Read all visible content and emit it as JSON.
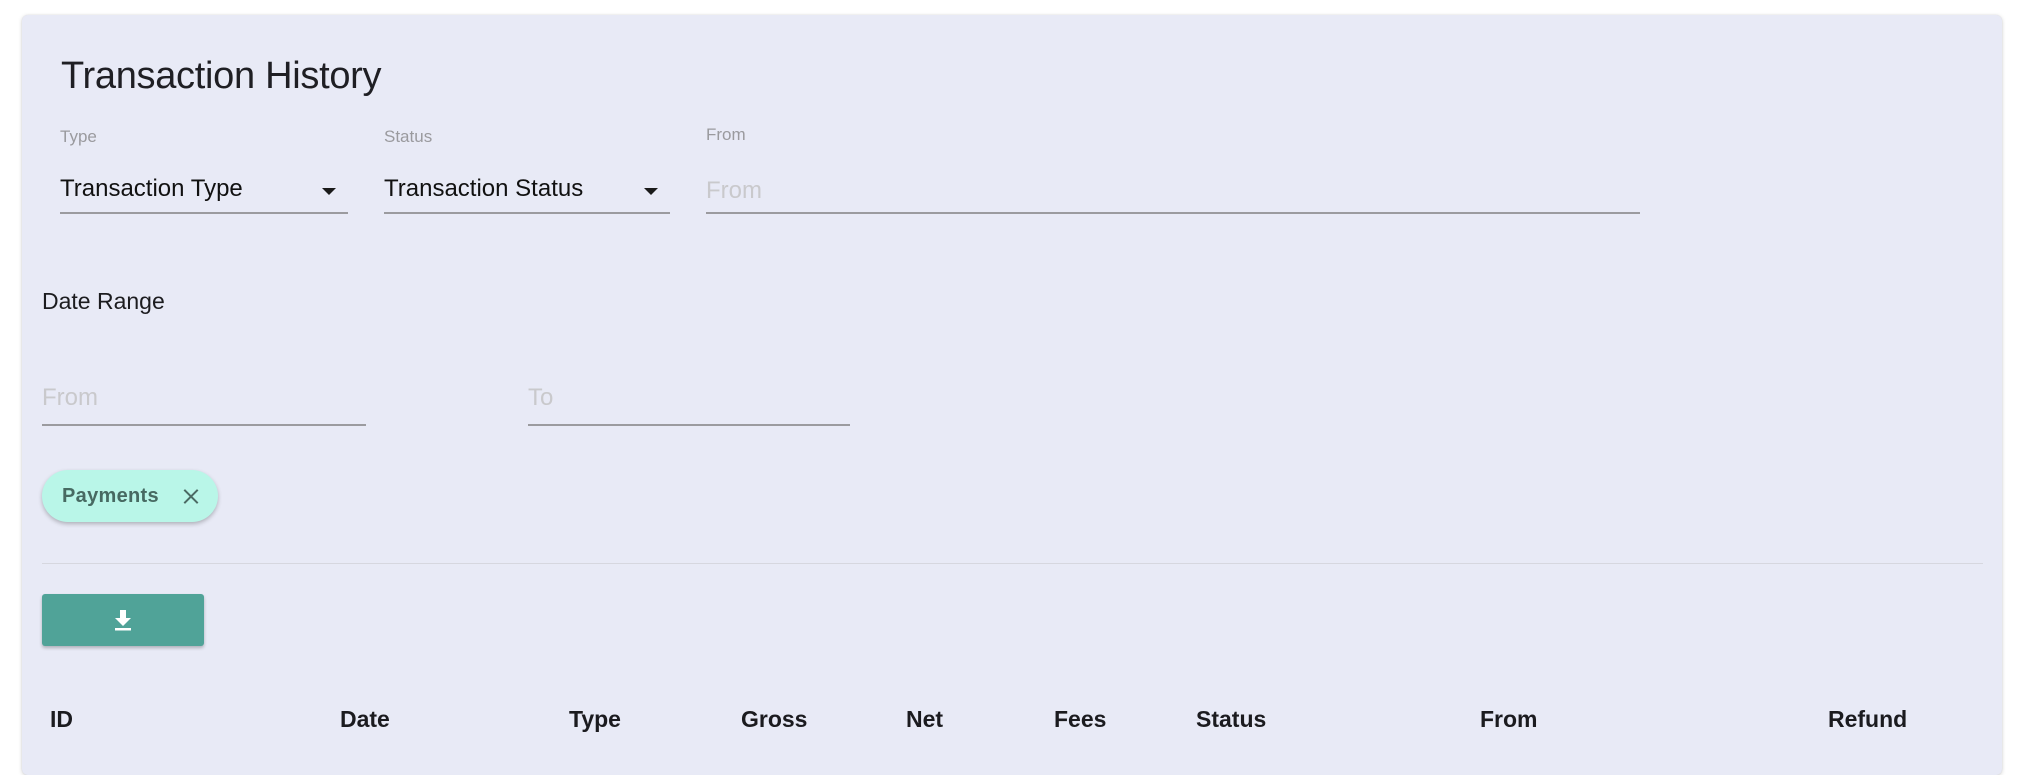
{
  "header": {
    "title": "Transaction History"
  },
  "filters": {
    "type": {
      "label": "Type",
      "value": "Transaction Type"
    },
    "status": {
      "label": "Status",
      "value": "Transaction Status"
    },
    "from": {
      "label": "From",
      "placeholder": "From"
    }
  },
  "date_range": {
    "label": "Date Range",
    "from_placeholder": "From",
    "to_placeholder": "To"
  },
  "active_filters": [
    {
      "label": "Payments",
      "close_icon": "close-icon"
    }
  ],
  "toolbar": {
    "download_icon": "download-icon"
  },
  "colors": {
    "card_background": "#e8eaf6",
    "chip_background": "#b9f6e8",
    "button_background": "#50a398"
  },
  "table": {
    "columns": [
      "ID",
      "Date",
      "Type",
      "Gross",
      "Net",
      "Fees",
      "Status",
      "From",
      "Refund"
    ]
  }
}
